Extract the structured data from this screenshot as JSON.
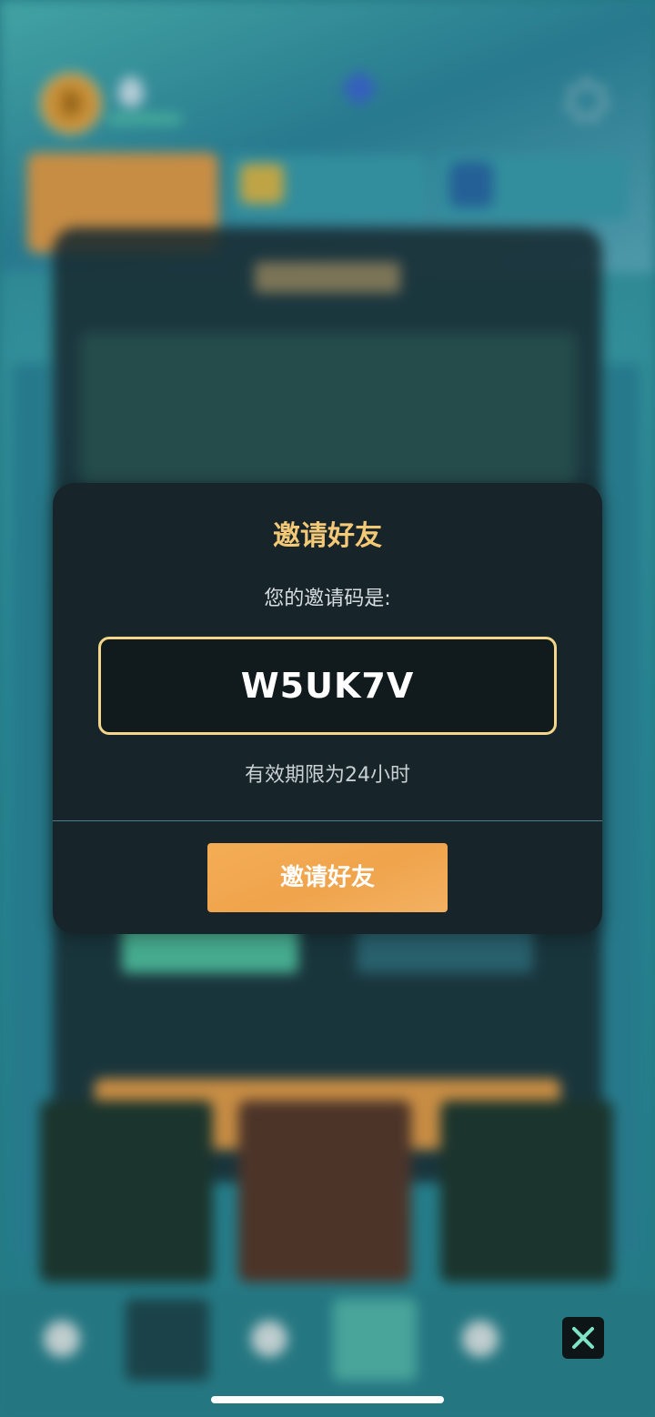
{
  "dialog": {
    "title": "邀请好友",
    "prompt": "您的邀请码是:",
    "invite_code": "W5UK7V",
    "validity_text": "有效期限为24小时",
    "invite_button_label": "邀请好友"
  },
  "colors": {
    "title": "#f3c876",
    "code_border": "#f3d68a",
    "button": "#f0a44c",
    "dialog_bg": "#17252a",
    "close_icon": "#7fe3c6"
  },
  "icons": {
    "close": "close-icon"
  }
}
